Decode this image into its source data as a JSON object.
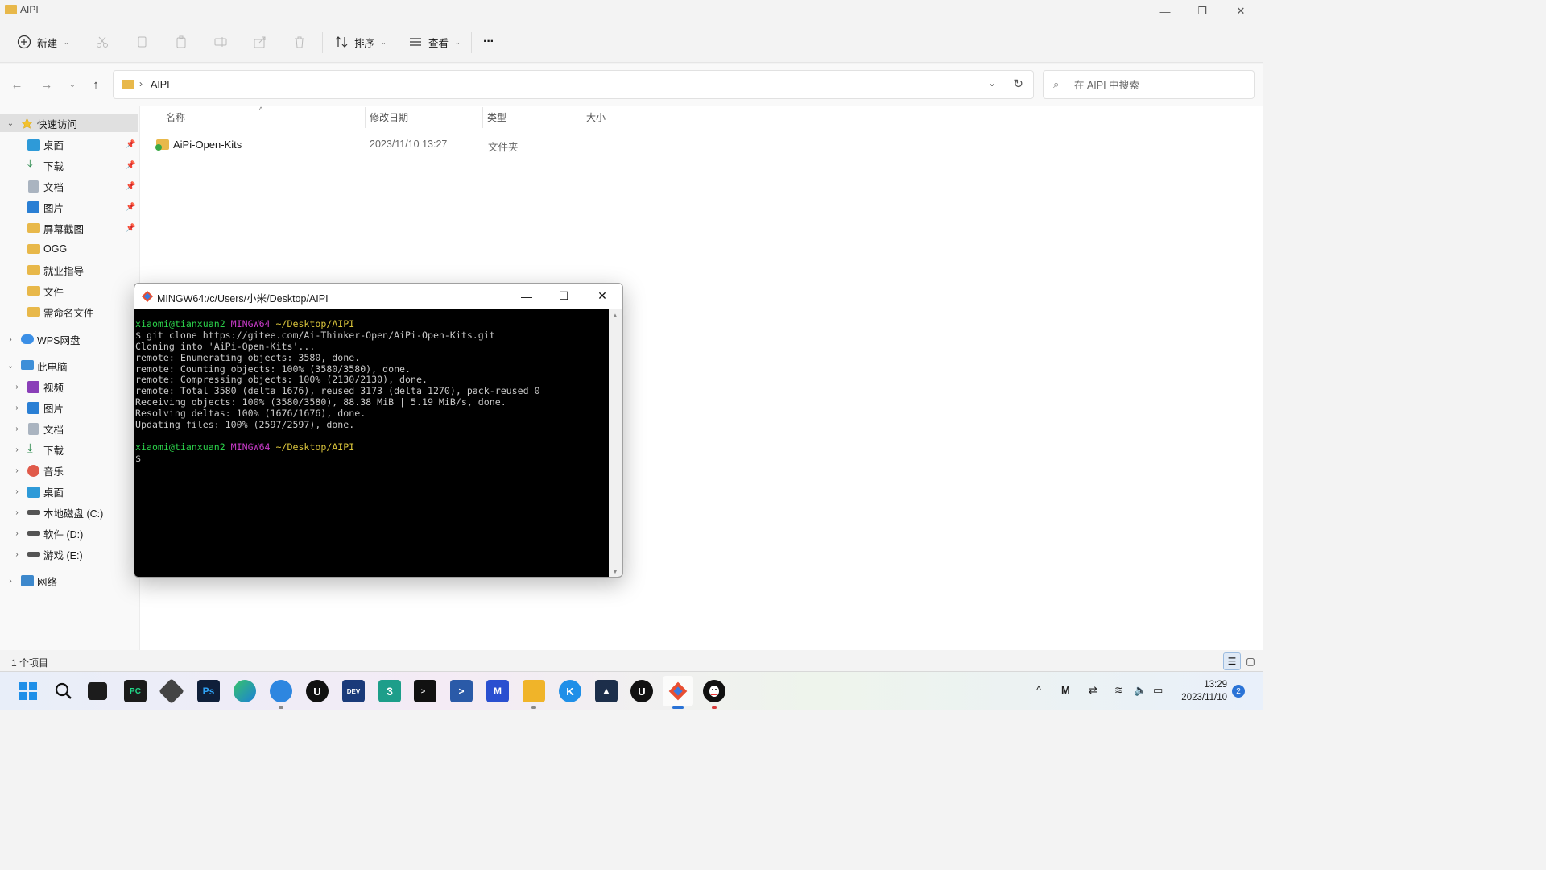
{
  "window": {
    "title": "AIPI"
  },
  "toolbar": {
    "new_label": "新建",
    "sort_label": "排序",
    "view_label": "查看",
    "more_label": "···"
  },
  "address": {
    "current": "AIPI",
    "search_placeholder": "在 AIPI 中搜索"
  },
  "sidebar": {
    "quick_access": "快速访问",
    "quick_items": [
      {
        "label": "桌面",
        "icon": "desktop-icon",
        "pinned": true
      },
      {
        "label": "下载",
        "icon": "download-icon",
        "pinned": true
      },
      {
        "label": "文档",
        "icon": "document-icon",
        "pinned": true
      },
      {
        "label": "图片",
        "icon": "pictures-icon",
        "pinned": true
      },
      {
        "label": "屏幕截图",
        "icon": "folder-icon",
        "pinned": true
      },
      {
        "label": "OGG",
        "icon": "folder-icon",
        "pinned": false
      },
      {
        "label": "就业指导",
        "icon": "folder-icon",
        "pinned": false
      },
      {
        "label": "文件",
        "icon": "folder-icon",
        "pinned": false
      },
      {
        "label": "需命名文件",
        "icon": "folder-icon",
        "pinned": false
      }
    ],
    "wps": "WPS网盘",
    "this_pc": "此电脑",
    "pc_items": [
      {
        "label": "视频",
        "icon": "video-icon"
      },
      {
        "label": "图片",
        "icon": "pictures-icon"
      },
      {
        "label": "文档",
        "icon": "document-icon"
      },
      {
        "label": "下载",
        "icon": "download-icon"
      },
      {
        "label": "音乐",
        "icon": "music-icon"
      },
      {
        "label": "桌面",
        "icon": "desktop-icon"
      },
      {
        "label": "本地磁盘 (C:)",
        "icon": "drive-icon"
      },
      {
        "label": "软件 (D:)",
        "icon": "drive-icon"
      },
      {
        "label": "游戏 (E:)",
        "icon": "drive-icon"
      }
    ],
    "network": "网络"
  },
  "columns": {
    "name": "名称",
    "date": "修改日期",
    "type": "类型",
    "size": "大小"
  },
  "files": [
    {
      "name": "AiPi-Open-Kits",
      "date": "2023/11/10 13:27",
      "type": "文件夹",
      "size": ""
    }
  ],
  "status": {
    "count": "1 个项目"
  },
  "terminal": {
    "title": "MINGW64:/c/Users/小米/Desktop/AIPI",
    "user_host": "xiaomi@tianxuan2",
    "env": "MINGW64",
    "cwd": "~/Desktop/AIPI",
    "command": "$ git clone https://gitee.com/Ai-Thinker-Open/AiPi-Open-Kits.git",
    "output": [
      "Cloning into 'AiPi-Open-Kits'...",
      "remote: Enumerating objects: 3580, done.",
      "remote: Counting objects: 100% (3580/3580), done.",
      "remote: Compressing objects: 100% (2130/2130), done.",
      "remote: Total 3580 (delta 1676), reused 3173 (delta 1270), pack-reused 0",
      "Receiving objects: 100% (3580/3580), 88.38 MiB | 5.19 MiB/s, done.",
      "Resolving deltas: 100% (1676/1676), done.",
      "Updating files: 100% (2597/2597), done."
    ],
    "prompt_end": "$ "
  },
  "taskbar": {
    "time": "13:29",
    "date": "2023/11/10",
    "notifications": "2",
    "apps": [
      "start-icon",
      "search-icon",
      "terminal-black-icon",
      "pycharm-icon",
      "unity-icon",
      "photoshop-icon",
      "edge-icon",
      "browser-icon",
      "unreal-icon",
      "devcpp-icon",
      "3dmax-icon",
      "cmd-icon",
      "powershell-icon",
      "vs-icon",
      "file-explorer-icon",
      "kugou-icon",
      "cat-icon",
      "unreal2-icon",
      "git-icon",
      "qq-icon"
    ]
  }
}
